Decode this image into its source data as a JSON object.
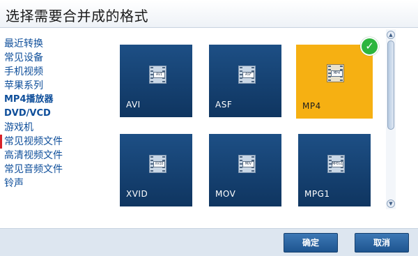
{
  "window": {
    "title": "选择需要合并成的格式"
  },
  "sidebar": {
    "items": [
      {
        "label": "最近转换"
      },
      {
        "label": "常见设备"
      },
      {
        "label": "手机视频"
      },
      {
        "label": "苹果系列"
      },
      {
        "label": "MP4播放器"
      },
      {
        "label": "DVD/VCD"
      },
      {
        "label": "游戏机"
      },
      {
        "label": "常见视频文件",
        "active": true
      },
      {
        "label": "高清视频文件"
      },
      {
        "label": "常见音频文件"
      },
      {
        "label": "铃声"
      }
    ]
  },
  "formats": [
    {
      "label": "AVI",
      "icon_tag": "AVI",
      "selected": false
    },
    {
      "label": "ASF",
      "icon_tag": "ASF",
      "selected": false
    },
    {
      "label": "MP4",
      "icon_tag": "MP4",
      "selected": true
    },
    {
      "label": "XVID",
      "icon_tag": "XVID",
      "selected": false
    },
    {
      "label": "MOV",
      "icon_tag": "MOV",
      "selected": false
    },
    {
      "label": "MPG1",
      "icon_tag": "MPEG1",
      "selected": false
    }
  ],
  "icons": {
    "selected_badge": "check-circle-icon",
    "format_icon": "video-file-icon",
    "scroll_up": "chevron-up-icon",
    "scroll_down": "chevron-down-icon"
  },
  "colors": {
    "tile_bg": "#1d4f85",
    "tile_selected_bg": "#f6b012",
    "link_color": "#0e4e9a",
    "active_marker": "#d8232a",
    "badge_green": "#2db53e",
    "button_bg": "#2a66a3"
  },
  "buttons": {
    "ok": "确定",
    "cancel": "取消"
  }
}
